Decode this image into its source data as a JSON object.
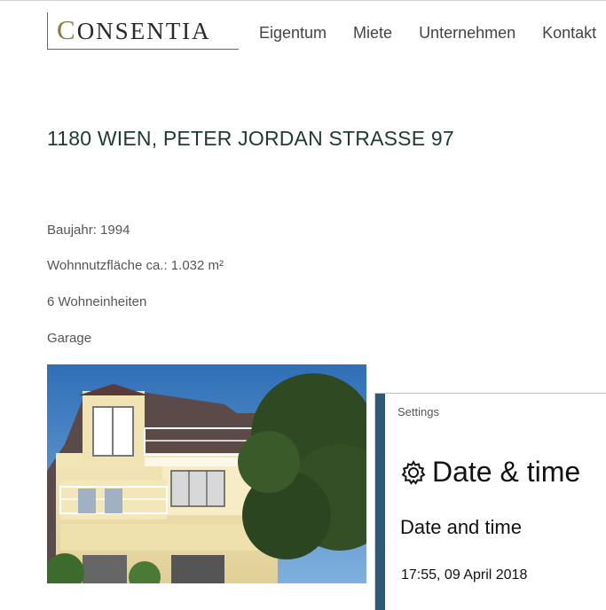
{
  "logo": {
    "first_letter": "C",
    "rest": "ONSENTIA"
  },
  "nav": {
    "items": [
      {
        "label": "Eigentum"
      },
      {
        "label": "Miete"
      },
      {
        "label": "Unternehmen"
      },
      {
        "label": "Kontakt"
      }
    ]
  },
  "property": {
    "title": "1180 WIEN, PETER JORDAN STRASSE 97",
    "facts": [
      "Baujahr: 1994",
      "Wohnnutzfläche ca.: 1.032 m²",
      "6 Wohneinheiten",
      "Garage"
    ]
  },
  "photo": {
    "icon": "building-photo"
  },
  "settings": {
    "app_name": "Settings",
    "page_title": "Date & time",
    "section_heading": "Date and time",
    "current_datetime": "17:55, 09 April 2018",
    "accent_color": "#2d5a78",
    "icon": "gear-icon"
  },
  "colors": {
    "logo_gold": "#8f7a3c",
    "title_green": "#1f3a32"
  }
}
